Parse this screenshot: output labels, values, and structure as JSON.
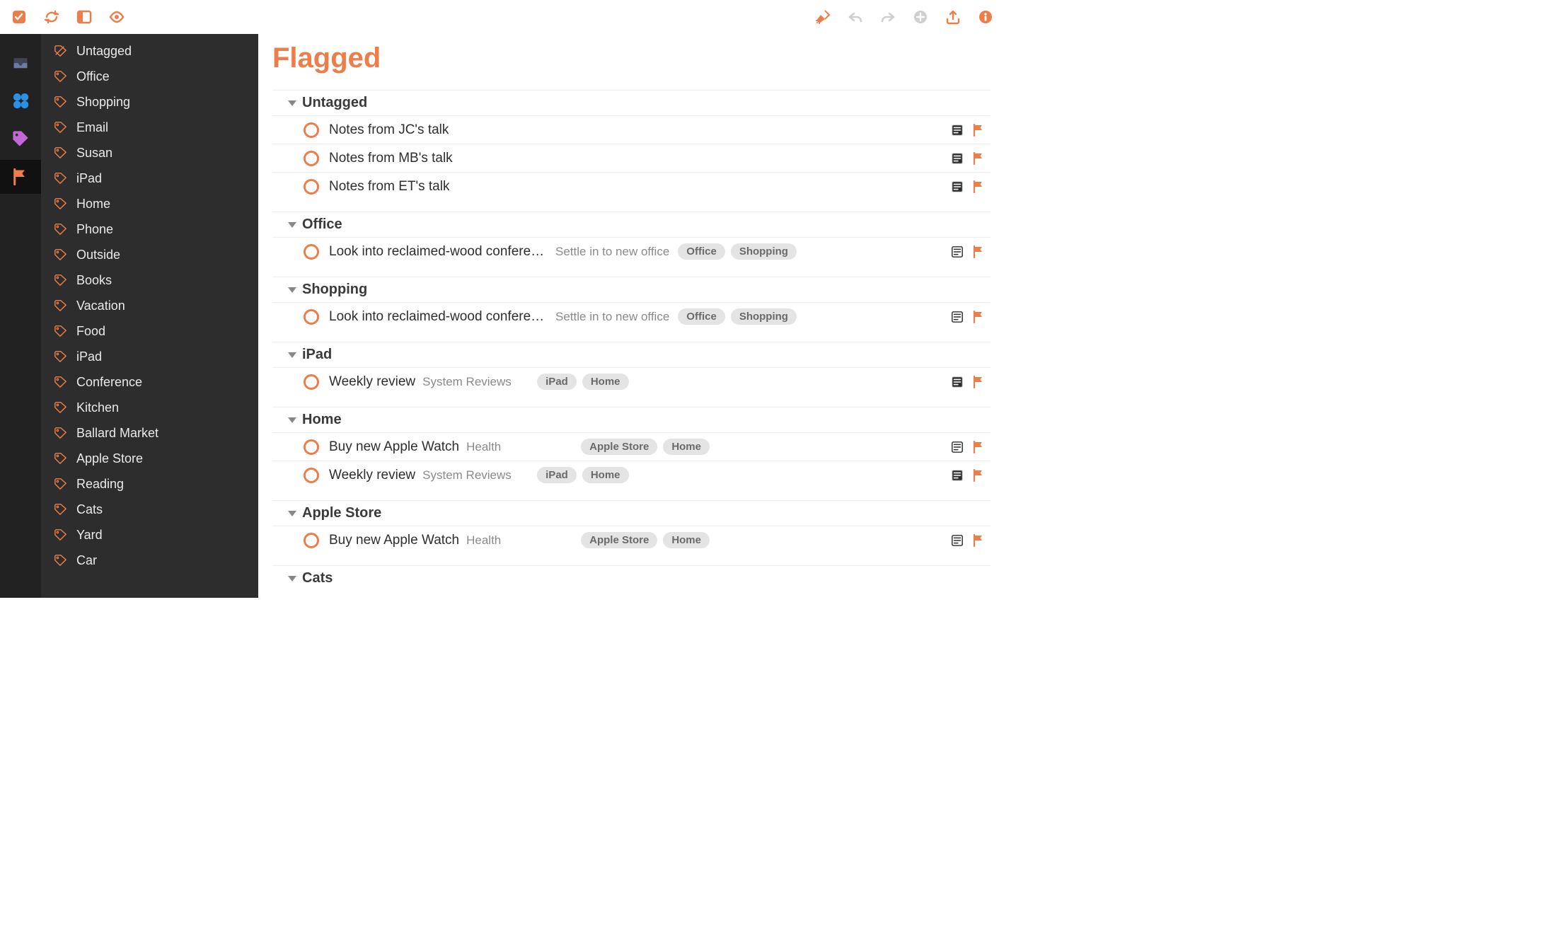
{
  "toolbar": {
    "left": [
      "check-icon",
      "sync-icon",
      "sidebar-toggle-icon",
      "eye-icon"
    ],
    "right": [
      "cleanup-icon",
      "undo-icon",
      "redo-icon",
      "add-icon",
      "export-icon",
      "info-icon"
    ]
  },
  "rail": {
    "items": [
      "inbox",
      "projects",
      "tags",
      "flagged"
    ],
    "active": "flagged"
  },
  "sidebar": {
    "items": [
      {
        "label": "Untagged",
        "kind": "untagged"
      },
      {
        "label": "Office",
        "kind": "tag"
      },
      {
        "label": "Shopping",
        "kind": "tag"
      },
      {
        "label": "Email",
        "kind": "tag"
      },
      {
        "label": "Susan",
        "kind": "tag"
      },
      {
        "label": "iPad",
        "kind": "tag"
      },
      {
        "label": "Home",
        "kind": "tag"
      },
      {
        "label": "Phone",
        "kind": "tag"
      },
      {
        "label": "Outside",
        "kind": "tag"
      },
      {
        "label": "Books",
        "kind": "tag"
      },
      {
        "label": "Vacation",
        "kind": "tag"
      },
      {
        "label": "Food",
        "kind": "tag"
      },
      {
        "label": "iPad",
        "kind": "tag"
      },
      {
        "label": "Conference",
        "kind": "tag"
      },
      {
        "label": "Kitchen",
        "kind": "tag"
      },
      {
        "label": "Ballard Market",
        "kind": "tag"
      },
      {
        "label": "Apple Store",
        "kind": "tag"
      },
      {
        "label": "Reading",
        "kind": "tag"
      },
      {
        "label": "Cats",
        "kind": "tag"
      },
      {
        "label": "Yard",
        "kind": "tag"
      },
      {
        "label": "Car",
        "kind": "tag"
      }
    ]
  },
  "main": {
    "title": "Flagged",
    "groups": [
      {
        "name": "Untagged",
        "tasks": [
          {
            "title": "Notes from JC's talk",
            "note": "grey"
          },
          {
            "title": "Notes from MB's talk",
            "note": "grey"
          },
          {
            "title": "Notes from ET's talk",
            "note": "grey"
          }
        ]
      },
      {
        "name": "Office",
        "tasks": [
          {
            "title": "Look into reclaimed-wood conferen…",
            "project": "Settle in to new office",
            "tags": [
              "Office",
              "Shopping"
            ],
            "note": "light"
          }
        ]
      },
      {
        "name": "Shopping",
        "tasks": [
          {
            "title": "Look into reclaimed-wood conferen…",
            "project": "Settle in to new office",
            "tags": [
              "Office",
              "Shopping"
            ],
            "note": "light"
          }
        ]
      },
      {
        "name": "iPad",
        "tasks": [
          {
            "title": "Weekly review",
            "project": "System Reviews",
            "tags": [
              "iPad",
              "Home"
            ],
            "note": "grey"
          }
        ]
      },
      {
        "name": "Home",
        "tasks": [
          {
            "title": "Buy new Apple Watch",
            "project": "Health",
            "tags": [
              "Apple Store",
              "Home"
            ],
            "note": "light"
          },
          {
            "title": "Weekly review",
            "project": "System Reviews",
            "tags": [
              "iPad",
              "Home"
            ],
            "note": "grey"
          }
        ]
      },
      {
        "name": "Apple Store",
        "tasks": [
          {
            "title": "Buy new Apple Watch",
            "project": "Health",
            "tags": [
              "Apple Store",
              "Home"
            ],
            "note": "light"
          }
        ]
      },
      {
        "name": "Cats",
        "tasks": []
      }
    ]
  }
}
